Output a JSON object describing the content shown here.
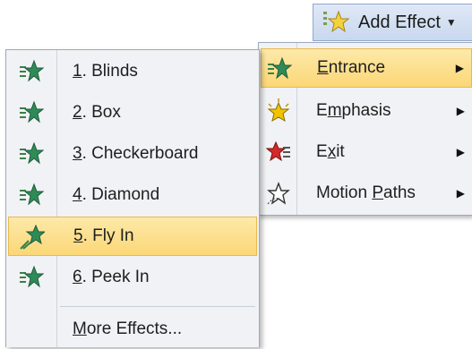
{
  "add_effect": {
    "label": "Add Effect",
    "icon": "add-effect-star-icon"
  },
  "categories": [
    {
      "prefix": "",
      "key": "E",
      "rest": "ntrance",
      "icon": "entrance-star-icon",
      "color": "#2e8b57",
      "selected": true
    },
    {
      "prefix": "E",
      "key": "m",
      "rest": "phasis",
      "icon": "emphasis-star-icon",
      "color": "#f2c300",
      "selected": false
    },
    {
      "prefix": "E",
      "key": "x",
      "rest": "it",
      "icon": "exit-star-icon",
      "color": "#d62828",
      "selected": false
    },
    {
      "prefix": "Motion ",
      "key": "P",
      "rest": "aths",
      "icon": "motion-paths-star-icon",
      "color": "#ffffff",
      "selected": false
    }
  ],
  "entrance_effects": [
    {
      "num": "1",
      "name": ". Blinds",
      "icon": "blinds-star-icon",
      "selected": false
    },
    {
      "num": "2",
      "name": ". Box",
      "icon": "box-star-icon",
      "selected": false
    },
    {
      "num": "3",
      "name": ". Checkerboard",
      "icon": "checkerboard-star-icon",
      "selected": false
    },
    {
      "num": "4",
      "name": ". Diamond",
      "icon": "diamond-star-icon",
      "selected": false
    },
    {
      "num": "5",
      "name": ". Fly In",
      "icon": "fly-in-star-icon",
      "selected": true
    },
    {
      "num": "6",
      "name": ". Peek In",
      "icon": "peek-in-star-icon",
      "selected": false
    }
  ],
  "more_effects": {
    "key": "M",
    "rest": "ore Effects..."
  }
}
